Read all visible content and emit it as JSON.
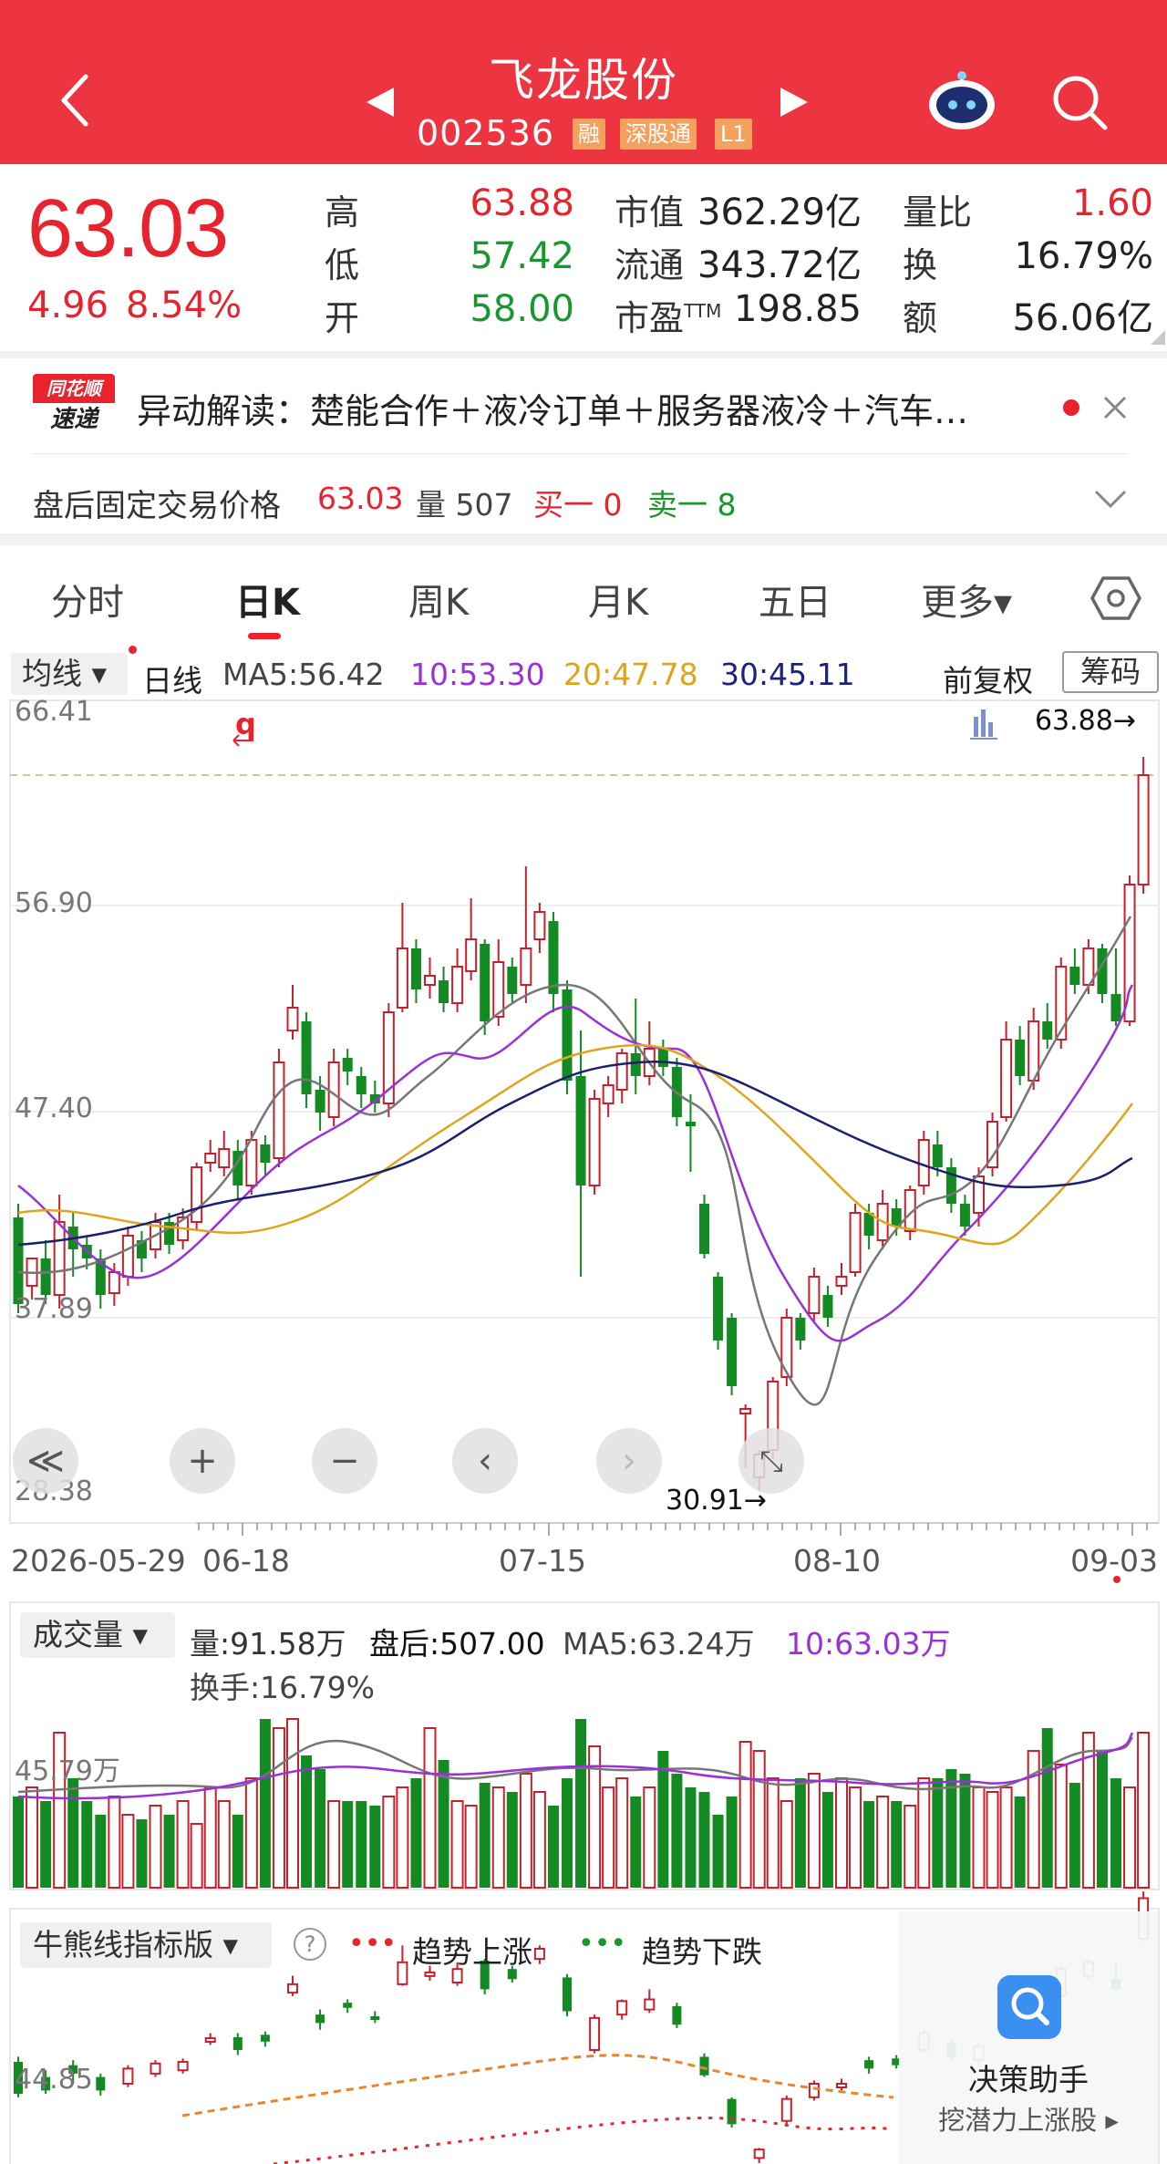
{
  "header": {
    "title": "飞龙股份",
    "code": "002536",
    "badges": [
      "融",
      "深股通",
      "L1"
    ]
  },
  "quote": {
    "price": "63.03",
    "change": "4.96",
    "change_pct": "8.54%",
    "high_label": "高",
    "high": "63.88",
    "low_label": "低",
    "low": "57.42",
    "open_label": "开",
    "open": "58.00",
    "mktcap_label": "市值",
    "mktcap": "362.29亿",
    "float_label": "流通",
    "float_cap": "343.72亿",
    "pe_label": "市盈",
    "pe_sup": "TTM",
    "pe": "198.85",
    "volratio_label": "量比",
    "volratio": "1.60",
    "turnover_label": "换",
    "turnover": "16.79%",
    "amount_label": "额",
    "amount": "56.06亿"
  },
  "news": {
    "logo_top": "同花顺",
    "logo_bottom": "速递",
    "text": "异动解读：楚能合作＋液冷订单＋服务器液冷＋汽车…"
  },
  "after_hours": {
    "label": "盘后固定交易价格",
    "price": "63.03",
    "volume": "量 507",
    "buy1": "买一 0",
    "sell1": "卖一 8"
  },
  "tabs": [
    "分时",
    "日K",
    "周K",
    "月K",
    "五日",
    "更多▾"
  ],
  "ma": {
    "dropdown": "均线 ▾",
    "period": "日线",
    "ma5": "MA5:56.42",
    "ma10": "10:53.30",
    "ma20": "20:47.78",
    "ma30": "30:45.11",
    "adjust": "前复权",
    "chips": "筹码"
  },
  "kchart": {
    "y_labels": [
      "66.41",
      "56.90",
      "47.40",
      "37.89",
      "28.38"
    ],
    "high_marker": "63.88→",
    "low_marker": "30.91→",
    "x_labels": [
      "2026-05-29",
      "06-18",
      "07-15",
      "08-10",
      "09-03"
    ]
  },
  "volume": {
    "dropdown": "成交量 ▾",
    "vol": "量:91.58万",
    "after": "盘后:507.00",
    "ma5": "MA5:63.24万",
    "ma10": "10:63.03万",
    "turnover": "换手:16.79%",
    "axis_label": "45.79万"
  },
  "indicator": {
    "dropdown": "牛熊线指标版 ▾",
    "help": "?",
    "up_label": "趋势上涨",
    "down_label": "趋势下跌",
    "axis_label": "44.85"
  },
  "assistant": {
    "title": "决策助手",
    "subtitle": "挖潜力上涨股 ▸"
  },
  "colors": {
    "header": "#ec3540",
    "up": "#c8202a",
    "down": "#138a22"
  }
}
